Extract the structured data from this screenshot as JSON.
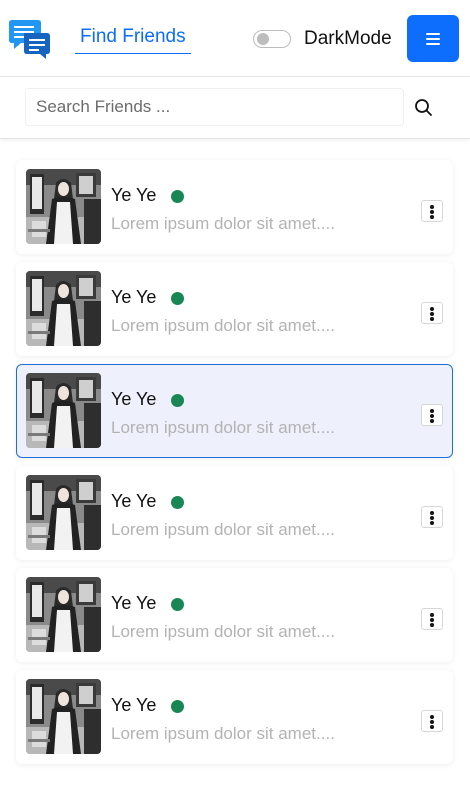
{
  "navbar": {
    "logo_icon": "chat-bubbles-icon",
    "nav_link": "Find Friends",
    "dark_mode_label": "DarkMode",
    "dark_mode_on": false,
    "menu_icon": "hamburger-icon",
    "accent_color": "#0d6efd"
  },
  "search": {
    "placeholder": "Search Friends ...",
    "value": "",
    "icon": "search-icon"
  },
  "friends": [
    {
      "name": "Ye Ye",
      "preview": "Lorem ipsum dolor sit amet....",
      "online": true,
      "active": false
    },
    {
      "name": "Ye Ye",
      "preview": "Lorem ipsum dolor sit amet....",
      "online": true,
      "active": false
    },
    {
      "name": "Ye Ye",
      "preview": "Lorem ipsum dolor sit amet....",
      "online": true,
      "active": true
    },
    {
      "name": "Ye Ye",
      "preview": "Lorem ipsum dolor sit amet....",
      "online": true,
      "active": false
    },
    {
      "name": "Ye Ye",
      "preview": "Lorem ipsum dolor sit amet....",
      "online": true,
      "active": false
    },
    {
      "name": "Ye Ye",
      "preview": "Lorem ipsum dolor sit amet....",
      "online": true,
      "active": false
    }
  ],
  "colors": {
    "online": "#198754",
    "active_bg": "#eef1fc",
    "active_border": "#1f6fd9"
  }
}
